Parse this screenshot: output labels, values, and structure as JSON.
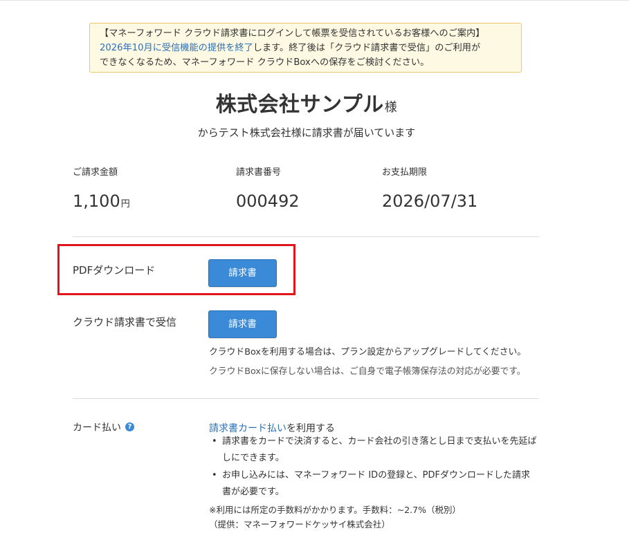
{
  "notice": {
    "line1": "【マネーフォワード クラウド請求書にログインして帳票を受信されているお客様へのご案内】",
    "line2_link": "2026年10月に受信機能の提供を終了",
    "line2_rest": "します。終了後は「クラウド請求書で受信」のご利用が",
    "line3": "できなくなるため、マネーフォワード クラウドBoxへの保存をご検討ください。"
  },
  "header": {
    "company": "株式会社サンプル",
    "honorific": "様",
    "subtitle": "からテスト株式会社様に請求書が届いています"
  },
  "summary": {
    "amount_label": "ご請求金額",
    "amount_value": "1,100",
    "amount_unit": "円",
    "number_label": "請求書番号",
    "number_value": "000492",
    "due_label": "お支払期限",
    "due_value": "2026/07/31"
  },
  "pdf": {
    "label": "PDFダウンロード",
    "button": "請求書"
  },
  "receive": {
    "label": "クラウド請求書で受信",
    "button": "請求書",
    "note1": "クラウドBoxを利用する場合は、プラン設定からアップグレードしてください。",
    "note2": "クラウドBoxに保存しない場合は、ご自身で電子帳簿保存法の対応が必要です。"
  },
  "card": {
    "label": "カード払い",
    "help_icon": "?",
    "link": "請求書カード払い",
    "link_suffix": "を利用する",
    "bullet1_line1": "請求書をカードで決済すると、カード会社の引き落とし日まで支払いを先延ば",
    "bullet1_line2": "しにできます。",
    "bullet2_line1": "お申し込みには、マネーフォワード IDの登録と、PDFダウンロードした請求",
    "bullet2_line2": "書が必要です。",
    "fee_note": "※利用には所定の手数料がかかります。手数料：~2.7%（税別）",
    "provider": "（提供：マネーフォワードケッサイ株式会社）"
  },
  "colors": {
    "button": "#3a8ad8",
    "link": "#2a6fb8",
    "notice_bg": "#fdf9e3",
    "highlight": "#e2141b"
  }
}
